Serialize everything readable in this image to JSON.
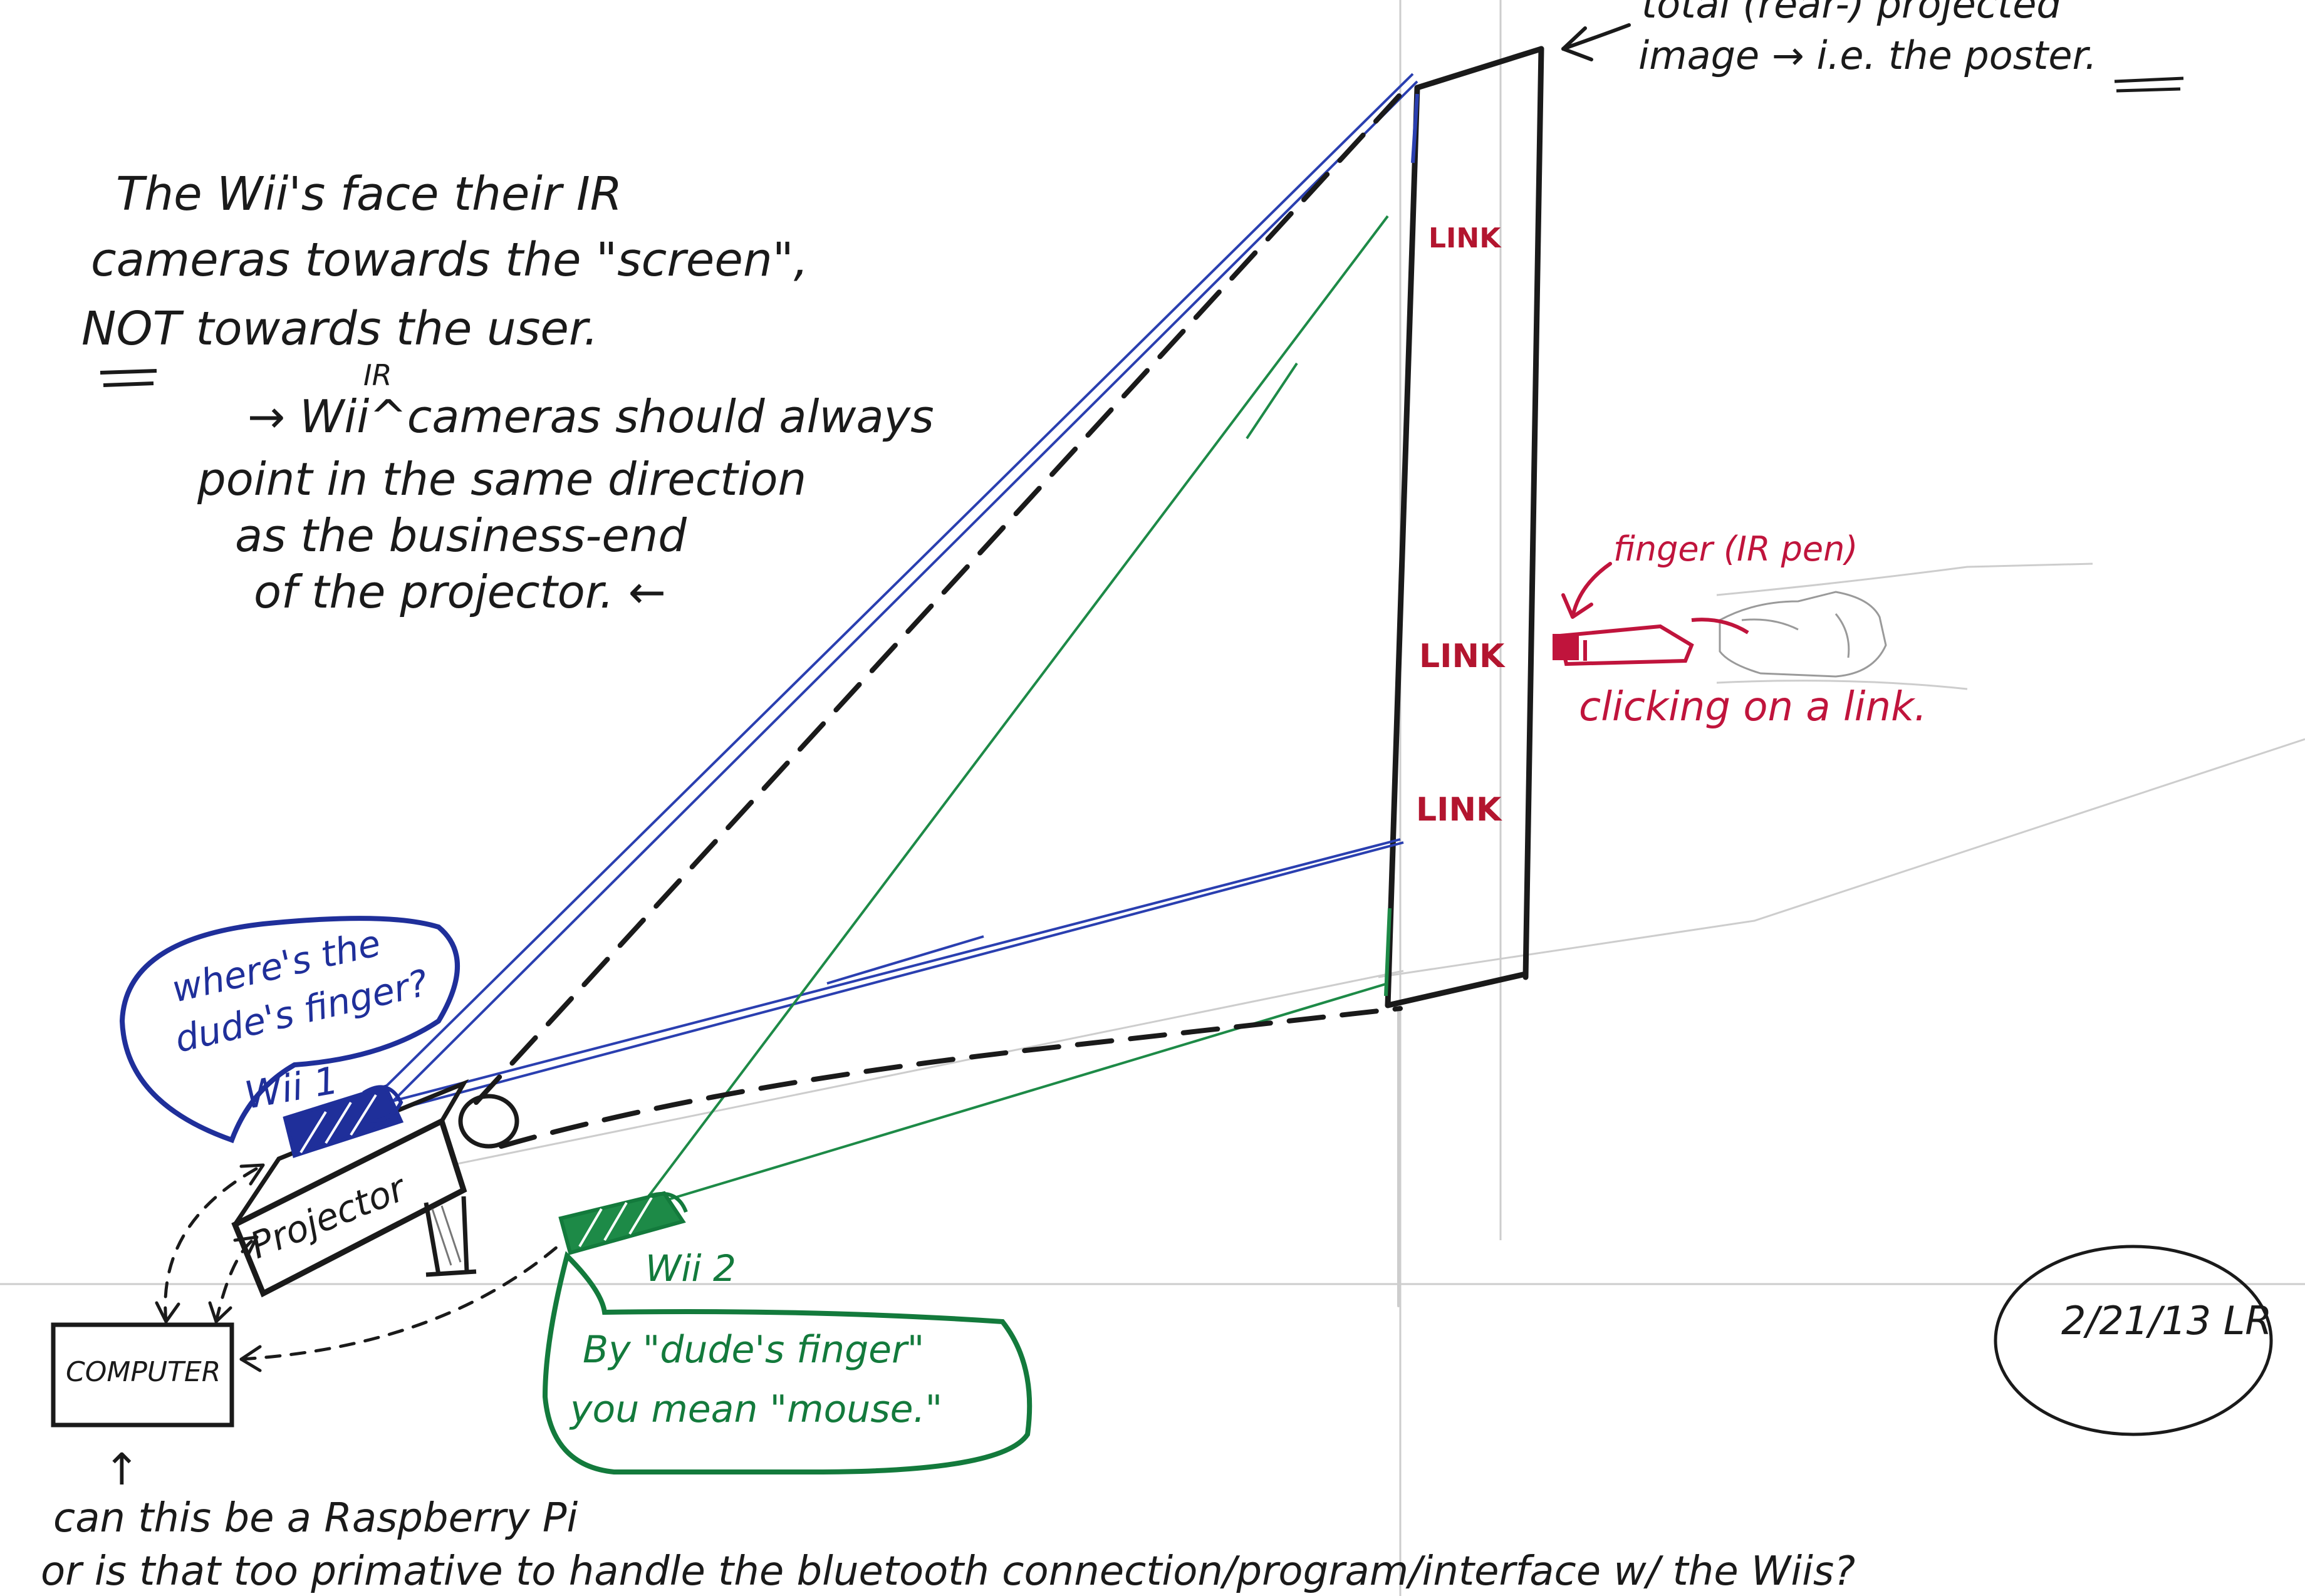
{
  "colors": {
    "black_ink": "#1a1a1a",
    "blue_ink": "#1f2f9a",
    "green_ink": "#137a3c",
    "red_ink": "#c0143c",
    "pencil": "#c9c9c9"
  },
  "poster": {
    "caption_line1": "total (rear-) projected",
    "caption_line2": "image → i.e. the poster.",
    "links": [
      "LINK",
      "LINK",
      "LINK"
    ]
  },
  "main_note": {
    "lines": [
      "The Wii's face their IR",
      "cameras towards the \"screen\",",
      "NOT towards the user."
    ],
    "sub_superscript": "IR",
    "sub_lines": [
      "→ Wii^cameras should always",
      "point in the same direction",
      "as the business-end",
      "of the projector. ←"
    ]
  },
  "finger": {
    "label": "finger (IR pen)",
    "caption": "clicking on a link."
  },
  "wii1": {
    "label": "Wii 1",
    "bubble_lines": [
      "where's the",
      "dude's finger?"
    ]
  },
  "wii2": {
    "label": "Wii 2",
    "bubble_lines": [
      "By \"dude's finger\"",
      "you mean \"mouse.\""
    ]
  },
  "projector": {
    "label": "Projector"
  },
  "computer": {
    "label": "COMPUTER"
  },
  "bottom_note": {
    "arrow": "↑",
    "line1": "can this be a Raspberry Pi",
    "line2": "or is that too primative to handle the bluetooth connection/program/interface w/ the Wiis?"
  },
  "signature": {
    "text": "2/21/13  LR"
  }
}
